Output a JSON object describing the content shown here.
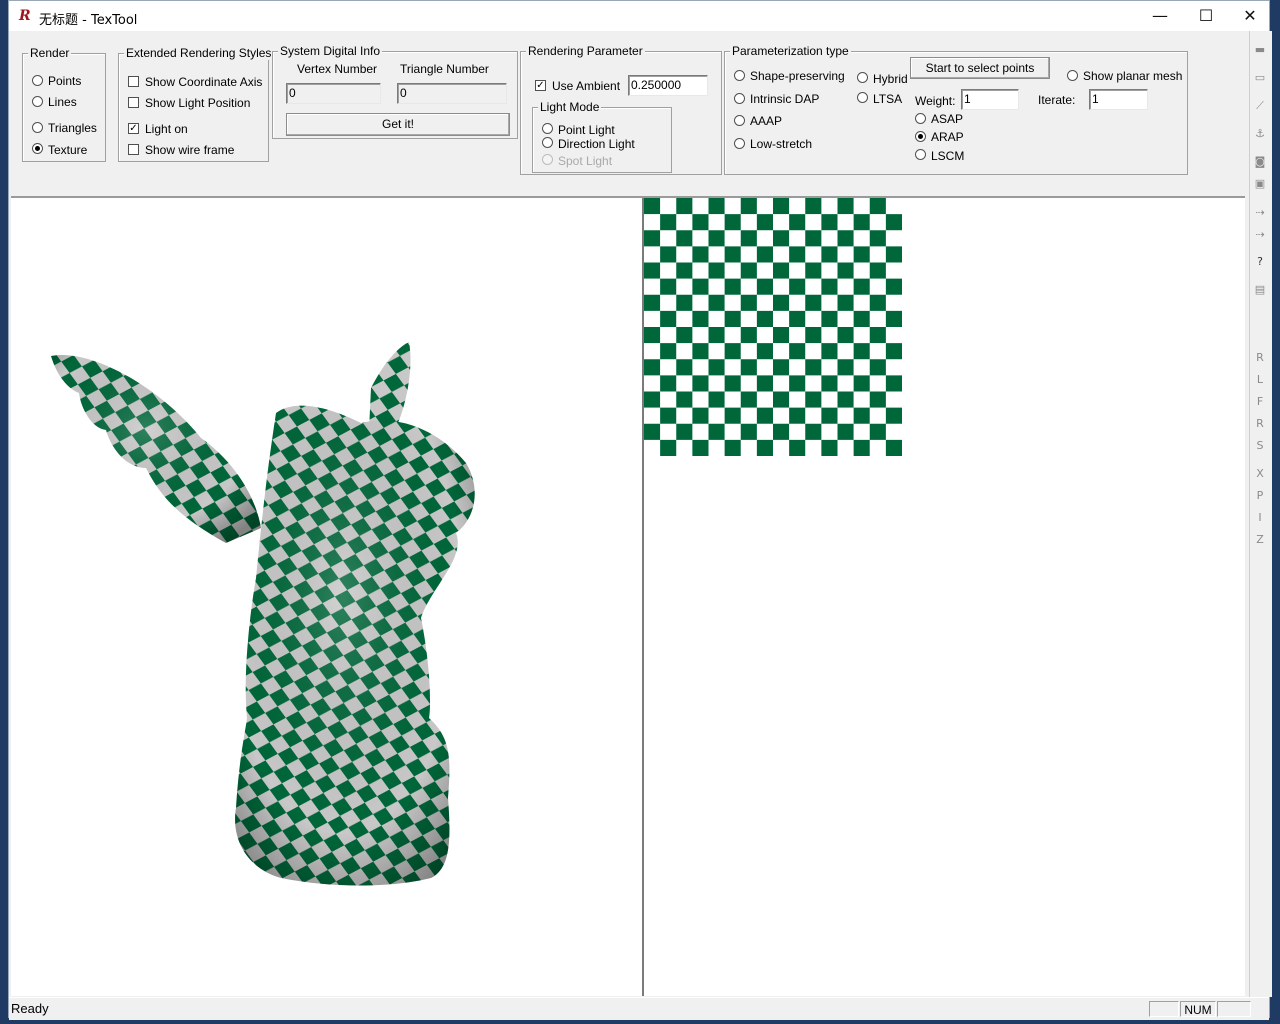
{
  "window": {
    "title": "无标题 - TexTool",
    "minimize_glyph": "—",
    "maximize_glyph": "☐",
    "close_glyph": "✕"
  },
  "render": {
    "title": "Render",
    "options": [
      "Points",
      "Lines",
      "Triangles",
      "Texture"
    ],
    "selected": "Texture"
  },
  "extended": {
    "title": "Extended Rendering Styles",
    "show_axis": "Show Coordinate Axis",
    "show_light_pos": "Show Light Position",
    "light_on": "Light on",
    "wire_frame": "Show wire frame",
    "checked": [
      "Light on"
    ]
  },
  "sysinfo": {
    "title": "System Digital Info",
    "vertex_label": "Vertex Number",
    "triangle_label": "Triangle Number",
    "vertex_value": "0",
    "triangle_value": "0",
    "get_button": "Get it!"
  },
  "rendering_param": {
    "title": "Rendering Parameter",
    "use_ambient": "Use Ambient",
    "use_ambient_checked": true,
    "ambient_value": "0.250000",
    "light_mode_title": "Light Mode",
    "point_light": "Point Light",
    "direction_light": "Direction Light",
    "spot_light": "Spot Light"
  },
  "param_type": {
    "title": "Parameterization type",
    "shape_preserving": "Shape-preserving",
    "intrinsic_dap": "Intrinsic DAP",
    "aaap": "AAAP",
    "low_stretch": "Low-stretch",
    "hybrid": "Hybrid",
    "ltsa": "LTSA",
    "select_points_button": "Start to select points",
    "show_planar_mesh": "Show planar mesh",
    "weight_label": "Weight:",
    "weight_value": "1",
    "iterate_label": "Iterate:",
    "iterate_value": "1",
    "asap": "ASAP",
    "arap": "ARAP",
    "lscm": "LSCM",
    "selected": "ARAP"
  },
  "checker_texture": {
    "rows": 16,
    "cols": 16,
    "color_a": "#00673a",
    "color_b": "#ffffff"
  },
  "statusbar": {
    "status_text": "Ready",
    "num_indicator": "NUM"
  },
  "side_strip": {
    "letters": [
      "R",
      "L",
      "F",
      "R",
      "S",
      "X",
      "P",
      "I",
      "Z"
    ]
  },
  "colors": {
    "model_green": "#00673a",
    "model_grey": "#c8c8c8"
  }
}
